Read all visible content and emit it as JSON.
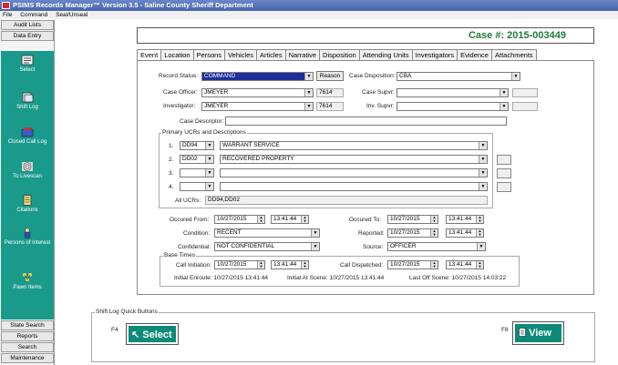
{
  "window": {
    "title": "PSIMS Records Manager™ Version 3.5 - Saline County Sheriff Department"
  },
  "menu": [
    "File",
    "Command",
    "Seal/Unseal"
  ],
  "sidebar": {
    "top_buttons": [
      "Audit Lists",
      "Data Entry"
    ],
    "nav": [
      "Select",
      "Shift Log",
      "Closed Call Log",
      "To Livescan",
      "Citations",
      "Persons of Interest",
      "Pawn Items"
    ],
    "bottom_buttons": [
      "State Search",
      "Reports",
      "Search",
      "Maintenance"
    ]
  },
  "case": {
    "label": "Case #: 2015-003449"
  },
  "tabs": [
    "Event",
    "Location",
    "Persons",
    "Vehicles",
    "Articles",
    "Narrative",
    "Disposition",
    "Attending Units",
    "Investigators",
    "Evidence",
    "Attachments"
  ],
  "form": {
    "record_status_label": "Record Status:",
    "record_status": "COMMAND",
    "reason_button": "Reason",
    "case_disposition_label": "Case Disposition:",
    "case_disposition": "CBA",
    "case_officer_label": "Case Officer:",
    "case_officer": "JMEYER",
    "case_officer_id": "7614",
    "case_supvr_label": "Case Supvr:",
    "case_supvr": "",
    "investigator_label": "Investigator:",
    "investigator": "JMEYER",
    "investigator_id": "7614",
    "inv_supvr_label": "Inv. Supvr:",
    "inv_supvr": "",
    "case_descriptor_label": "Case Descriptor:",
    "case_descriptor": "",
    "ucr_group_title": "Primary UCRs and Descriptions",
    "ucrs": [
      {
        "num": "1.",
        "code": "DD94",
        "desc": "WARRANT SERVICE"
      },
      {
        "num": "2.",
        "code": "DD02",
        "desc": "RECOVERED PROPERTY"
      },
      {
        "num": "3.",
        "code": "",
        "desc": ""
      },
      {
        "num": "4.",
        "code": "",
        "desc": ""
      }
    ],
    "all_ucrs_label": "All UCRs:",
    "all_ucrs": "DD94,DD02",
    "occurred_from_label": "Occured From:",
    "occurred_from_date": "10/27/2015",
    "occurred_from_time": "13:41:44",
    "occurred_to_label": "Occured To:",
    "occurred_to_date": "10/27/2015",
    "occurred_to_time": "13:41:44",
    "condition_label": "Condition:",
    "condition": "RECENT",
    "reported_label": "Reported:",
    "reported_date": "10/27/2015",
    "reported_time": "13:41:44",
    "confidential_label": "Confidential:",
    "confidential": "NOT CONFIDENTIAL",
    "source_label": "Source:",
    "source": "OFFICER",
    "base_times_title": "Base Times",
    "call_initiation_label": "Call Initiation:",
    "call_initiation_date": "10/27/2015",
    "call_initiation_time": "13:41:44",
    "call_dispatched_label": "Call Dispatched:",
    "call_dispatched_date": "10/27/2015",
    "call_dispatched_time": "13:41:44",
    "initial_enroute": "Initial Enroute:   10/27/2015 13:41:44",
    "initial_at_scene": "Initial At Scene:   10/27/2015 13:41:44",
    "last_off_scene": "Last Off Scene:   10/27/2015 14:03:22"
  },
  "shift_log": {
    "title": "Shift Log Quick Buttons",
    "f4_label": "F4",
    "select_label": "Select",
    "f8_label": "F8",
    "view_label": "View"
  }
}
